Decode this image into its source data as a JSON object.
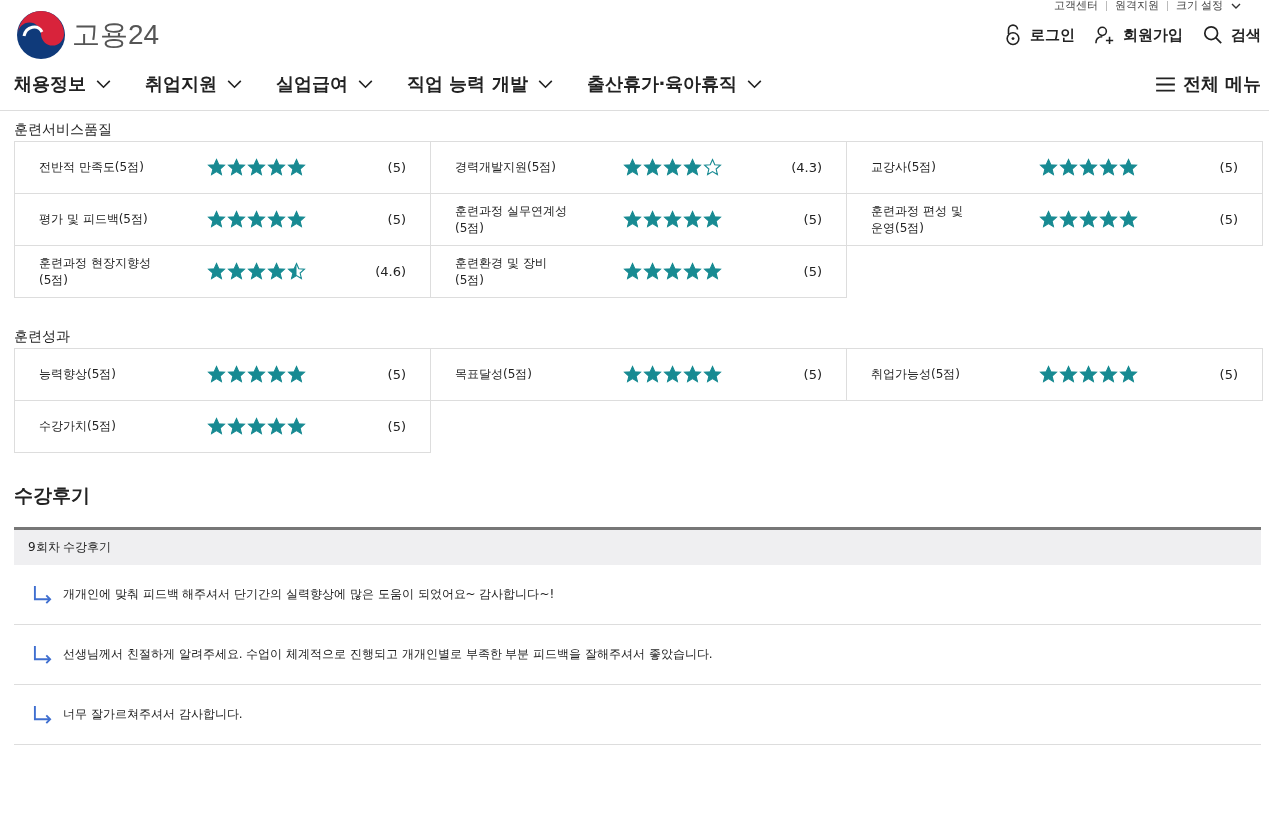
{
  "utility_links": [
    "고객센터",
    "원격지원",
    "크기 설정"
  ],
  "logo": {
    "text": "고용24"
  },
  "user_links": [
    {
      "kind": "login",
      "label": "로그인"
    },
    {
      "kind": "join",
      "label": "회원가입"
    },
    {
      "kind": "search",
      "label": "검색"
    }
  ],
  "nav": {
    "items": [
      "채용정보",
      "취업지원",
      "실업급여",
      "직업 능력 개발",
      "출산휴가·육아휴직"
    ],
    "all_menu": "전체 메뉴"
  },
  "sections": [
    {
      "title": "훈련서비스품질",
      "ratings": [
        {
          "label": "전반적 만족도(5점)",
          "stars": 5,
          "score": "(5)"
        },
        {
          "label": "경력개발지원(5점)",
          "stars": 4,
          "score": "(4.3)"
        },
        {
          "label": "교강사(5점)",
          "stars": 5,
          "score": "(5)"
        },
        {
          "label": "평가 및 피드백(5점)",
          "stars": 5,
          "score": "(5)"
        },
        {
          "label": "훈련과정 실무연계성(5점)",
          "stars": 5,
          "score": "(5)"
        },
        {
          "label": "훈련과정 편성 및 운영(5점)",
          "stars": 5,
          "score": "(5)"
        },
        {
          "label": "훈련과정 현장지향성(5점)",
          "stars": 4.5,
          "score": "(4.6)"
        },
        {
          "label": "훈련환경 및 장비(5점)",
          "stars": 5,
          "score": "(5)"
        }
      ]
    },
    {
      "title": "훈련성과",
      "ratings": [
        {
          "label": "능력향상(5점)",
          "stars": 5,
          "score": "(5)"
        },
        {
          "label": "목표달성(5점)",
          "stars": 5,
          "score": "(5)"
        },
        {
          "label": "취업가능성(5점)",
          "stars": 5,
          "score": "(5)"
        },
        {
          "label": "수강가치(5점)",
          "stars": 5,
          "score": "(5)"
        }
      ]
    }
  ],
  "reviews": {
    "title": "수강후기",
    "round": "9회차 수강후기",
    "items": [
      "개개인에 맞춰 피드백 해주셔서 단기간의 실력향상에 많은 도움이 되었어요~ 감사합니다~!",
      "선생님께서 친절하게 알려주세요. 수업이 체계적으로 진행되고 개개인별로 부족한 부분 피드백을 잘해주셔서 좋았습니다.",
      "너무 잘가르쳐주셔서 감사합니다."
    ]
  }
}
